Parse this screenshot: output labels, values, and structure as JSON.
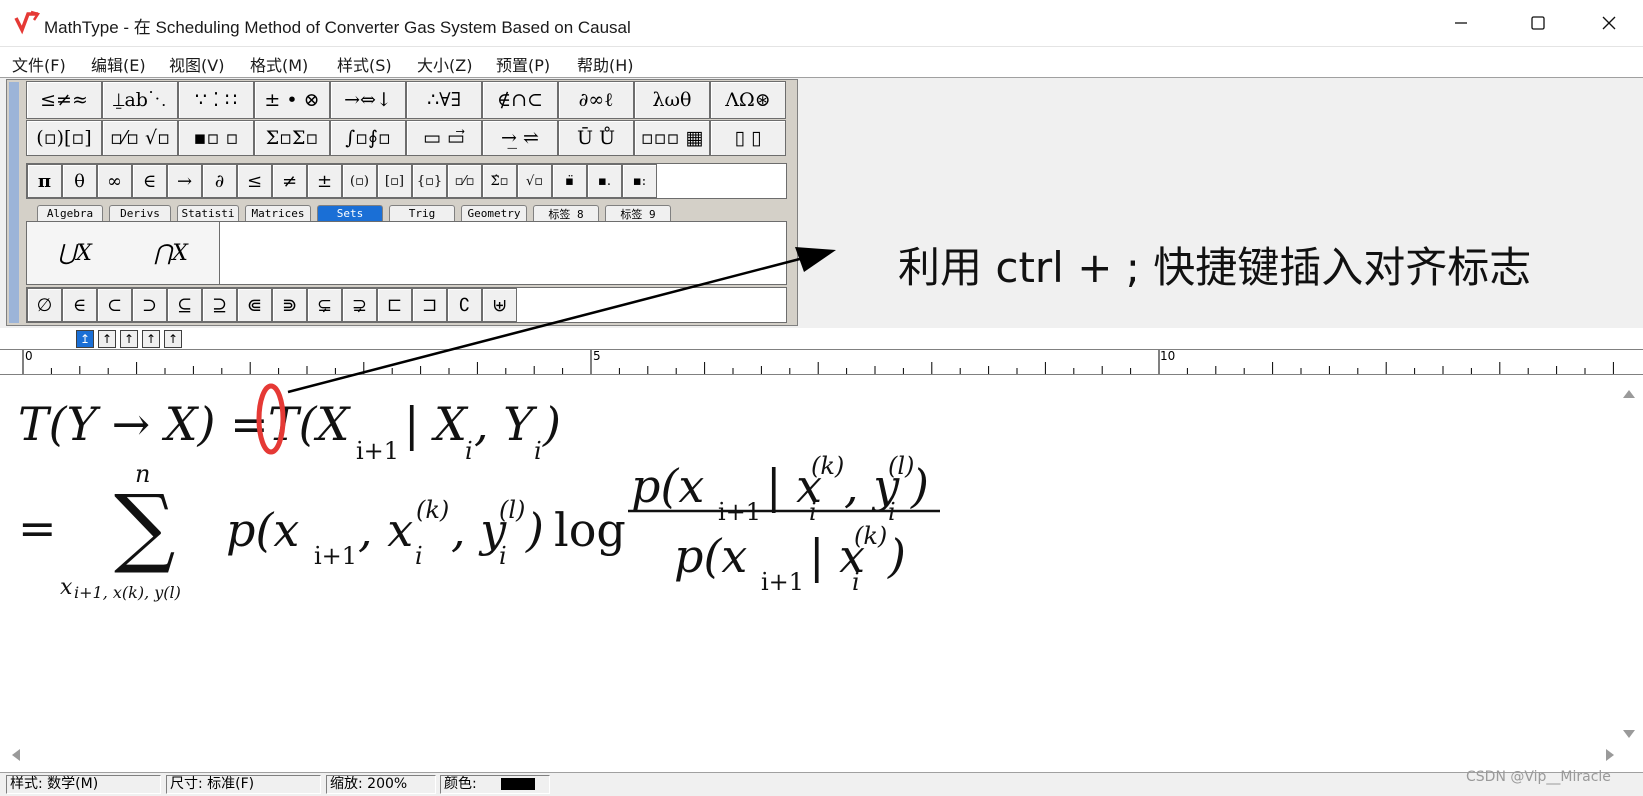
{
  "window": {
    "title": "MathType - 在 Scheduling Method of Converter Gas System Based on Causal",
    "minimize_icon": "minimize-icon",
    "maximize_icon": "maximize-icon",
    "close_icon": "close-icon"
  },
  "menu": [
    "文件(F)",
    "编辑(E)",
    "视图(V)",
    "格式(M)",
    "样式(S)",
    "大小(Z)",
    "预置(P)",
    "帮助(H)"
  ],
  "palette": {
    "row1": [
      "≤≠≈",
      "⍊ab⋱",
      "∵ ⁚ ∷",
      "± • ⊗",
      "→⇔↓",
      "∴∀∃",
      "∉∩⊂",
      "∂∞ℓ",
      "λωθ",
      "ΛΩ⊛"
    ],
    "row2": [
      "(▫)[▫]",
      "▫⁄▫ √▫",
      "▪▫ ▫",
      "Σ▫Σ▫",
      "∫▫∮▫",
      "▭ ▭⃗",
      "→̲ ⇌",
      "Ū Ů",
      "▫▫▫ ▦",
      "▯ ▯"
    ],
    "row3": [
      "π",
      "θ",
      "∞",
      "∈",
      "→",
      "∂",
      "≤",
      "≠",
      "±",
      "(▫)",
      "[▫]",
      "{▫}",
      "▫⁄▫",
      "Σ̂▫",
      "√▫",
      "▪̈",
      "▪.",
      "▪:"
    ],
    "tabs": [
      "Algebra",
      "Derivs",
      "Statisti",
      "Matrices",
      "Sets",
      "Trig",
      "Geometry",
      "标签 8",
      "标签 9"
    ],
    "active_tab": "Sets",
    "big_templates": [
      "⋃X",
      "⋂X"
    ],
    "row5": [
      "∅",
      "∈",
      "⊂",
      "⊃",
      "⊆",
      "⊇",
      "⋐",
      "⋑",
      "⊊",
      "⊋",
      "⊏",
      "⊐",
      "∁",
      "⊎"
    ]
  },
  "ruler": {
    "marks": [
      "0",
      "5",
      "10"
    ]
  },
  "equation": {
    "line1_lhs": "T(Y → X) =",
    "line1_rhs": "T(X",
    "line1_sub1": "i+1",
    "line1_mid": "| X",
    "line1_sub2": "i",
    "line1_mid2": ", Y",
    "line1_sub3": "i",
    "line1_end": ")",
    "line2_eq": "=",
    "sum_top": "n",
    "sum_symbol": "∑",
    "sum_bottom": "x",
    "sum_bottom_full": "i+1, x(k), y(l)",
    "term": "p(x",
    "log": "log",
    "frac_num": "p(x",
    "frac_den": "p(x"
  },
  "annotation": {
    "text": "利用 ctrl + ; 快捷键插入对齐标志",
    "arrow_color": "#000000",
    "marker_color": "#e53935"
  },
  "status": {
    "style": "样式: 数学(M)",
    "size": "尺寸: 标准(F)",
    "zoom": "缩放: 200%",
    "color": "颜色:"
  },
  "watermark": "CSDN @Vip__Miracle"
}
